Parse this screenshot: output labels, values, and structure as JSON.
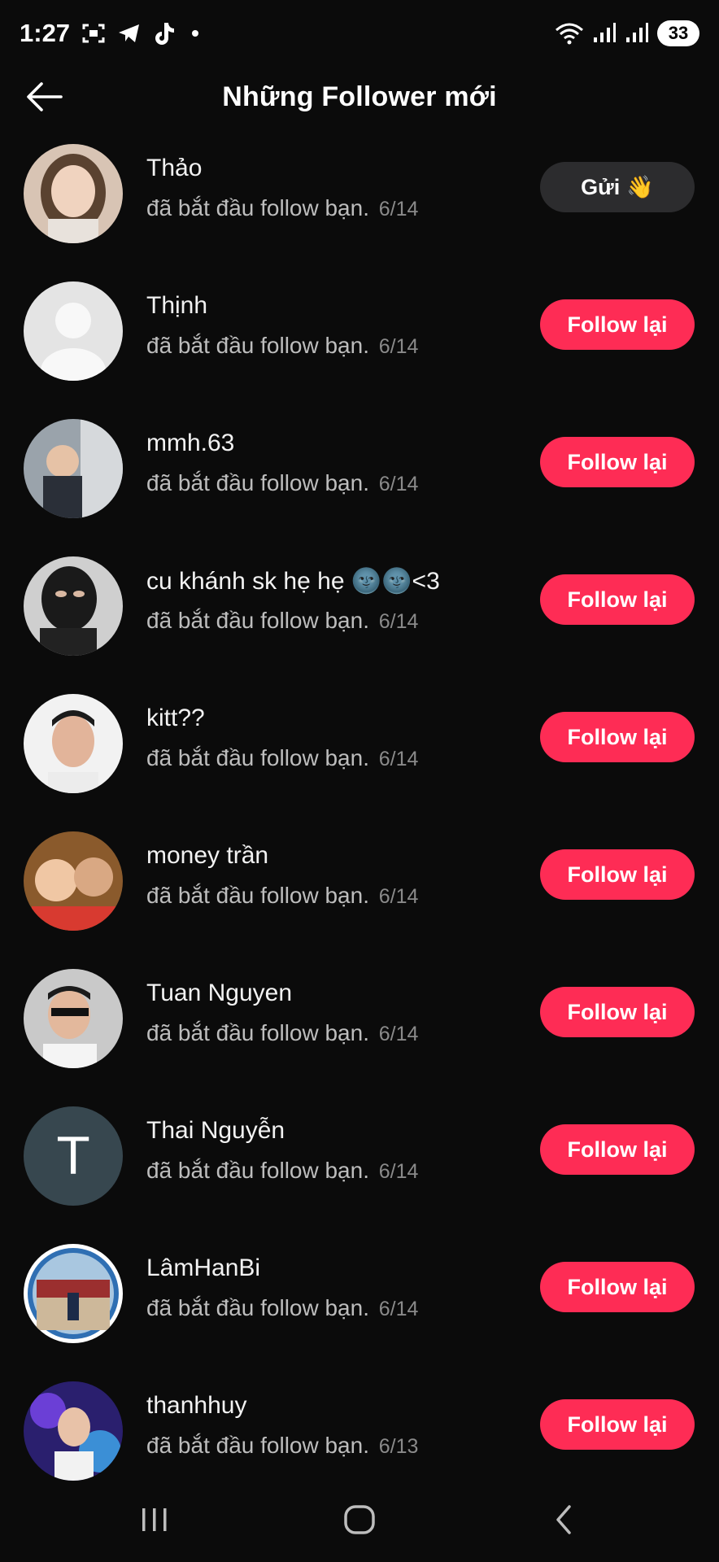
{
  "status_bar": {
    "time": "1:27",
    "battery": "33",
    "icons": [
      "screenshot-icon",
      "telegram-icon",
      "tiktok-icon",
      "wifi-icon",
      "signal-icon"
    ]
  },
  "header": {
    "title": "Những Follower mới",
    "back_icon": "back-arrow-icon"
  },
  "followers": [
    {
      "name": "Thảo",
      "subtitle": "đã bắt đầu follow bạn.",
      "date": "6/14",
      "button": "Gửi",
      "button_icon": "wave-emoji",
      "button_style": "send"
    },
    {
      "name": "Thịnh",
      "subtitle": "đã bắt đầu follow bạn.",
      "date": "6/14",
      "button": "Follow lại",
      "button_style": "follow"
    },
    {
      "name": "mmh.63",
      "subtitle": "đã bắt đầu follow bạn.",
      "date": "6/14",
      "button": "Follow lại",
      "button_style": "follow"
    },
    {
      "name": "cu khánh sk hẹ hẹ 🌚🌚<3",
      "subtitle": "đã bắt đầu follow bạn.",
      "date": "6/14",
      "button": "Follow lại",
      "button_style": "follow"
    },
    {
      "name": "kitt??",
      "subtitle": "đã bắt đầu follow bạn.",
      "date": "6/14",
      "button": "Follow lại",
      "button_style": "follow"
    },
    {
      "name": "money trần",
      "subtitle": "đã bắt đầu follow bạn.",
      "date": "6/14",
      "button": "Follow lại",
      "button_style": "follow"
    },
    {
      "name": "Tuan Nguyen",
      "subtitle": "đã bắt đầu follow bạn.",
      "date": "6/14",
      "button": "Follow lại",
      "button_style": "follow"
    },
    {
      "name": "Thai Nguyễn",
      "subtitle": "đã bắt đầu follow bạn.",
      "date": "6/14",
      "button": "Follow lại",
      "button_style": "follow",
      "avatar_letter": "T"
    },
    {
      "name": "LâmHanBi",
      "subtitle": "đã bắt đầu follow bạn.",
      "date": "6/14",
      "button": "Follow lại",
      "button_style": "follow"
    },
    {
      "name": "thanhhuy",
      "subtitle": "đã bắt đầu follow bạn.",
      "date": "6/13",
      "button": "Follow lại",
      "button_style": "follow"
    }
  ],
  "colors": {
    "background": "#0b0b0b",
    "follow_button": "#fe2c55",
    "send_button": "#2c2c2e",
    "date_text": "#8a8a8a"
  },
  "nav_bar": {
    "icons": [
      "recent-apps-icon",
      "home-icon",
      "back-icon"
    ]
  }
}
